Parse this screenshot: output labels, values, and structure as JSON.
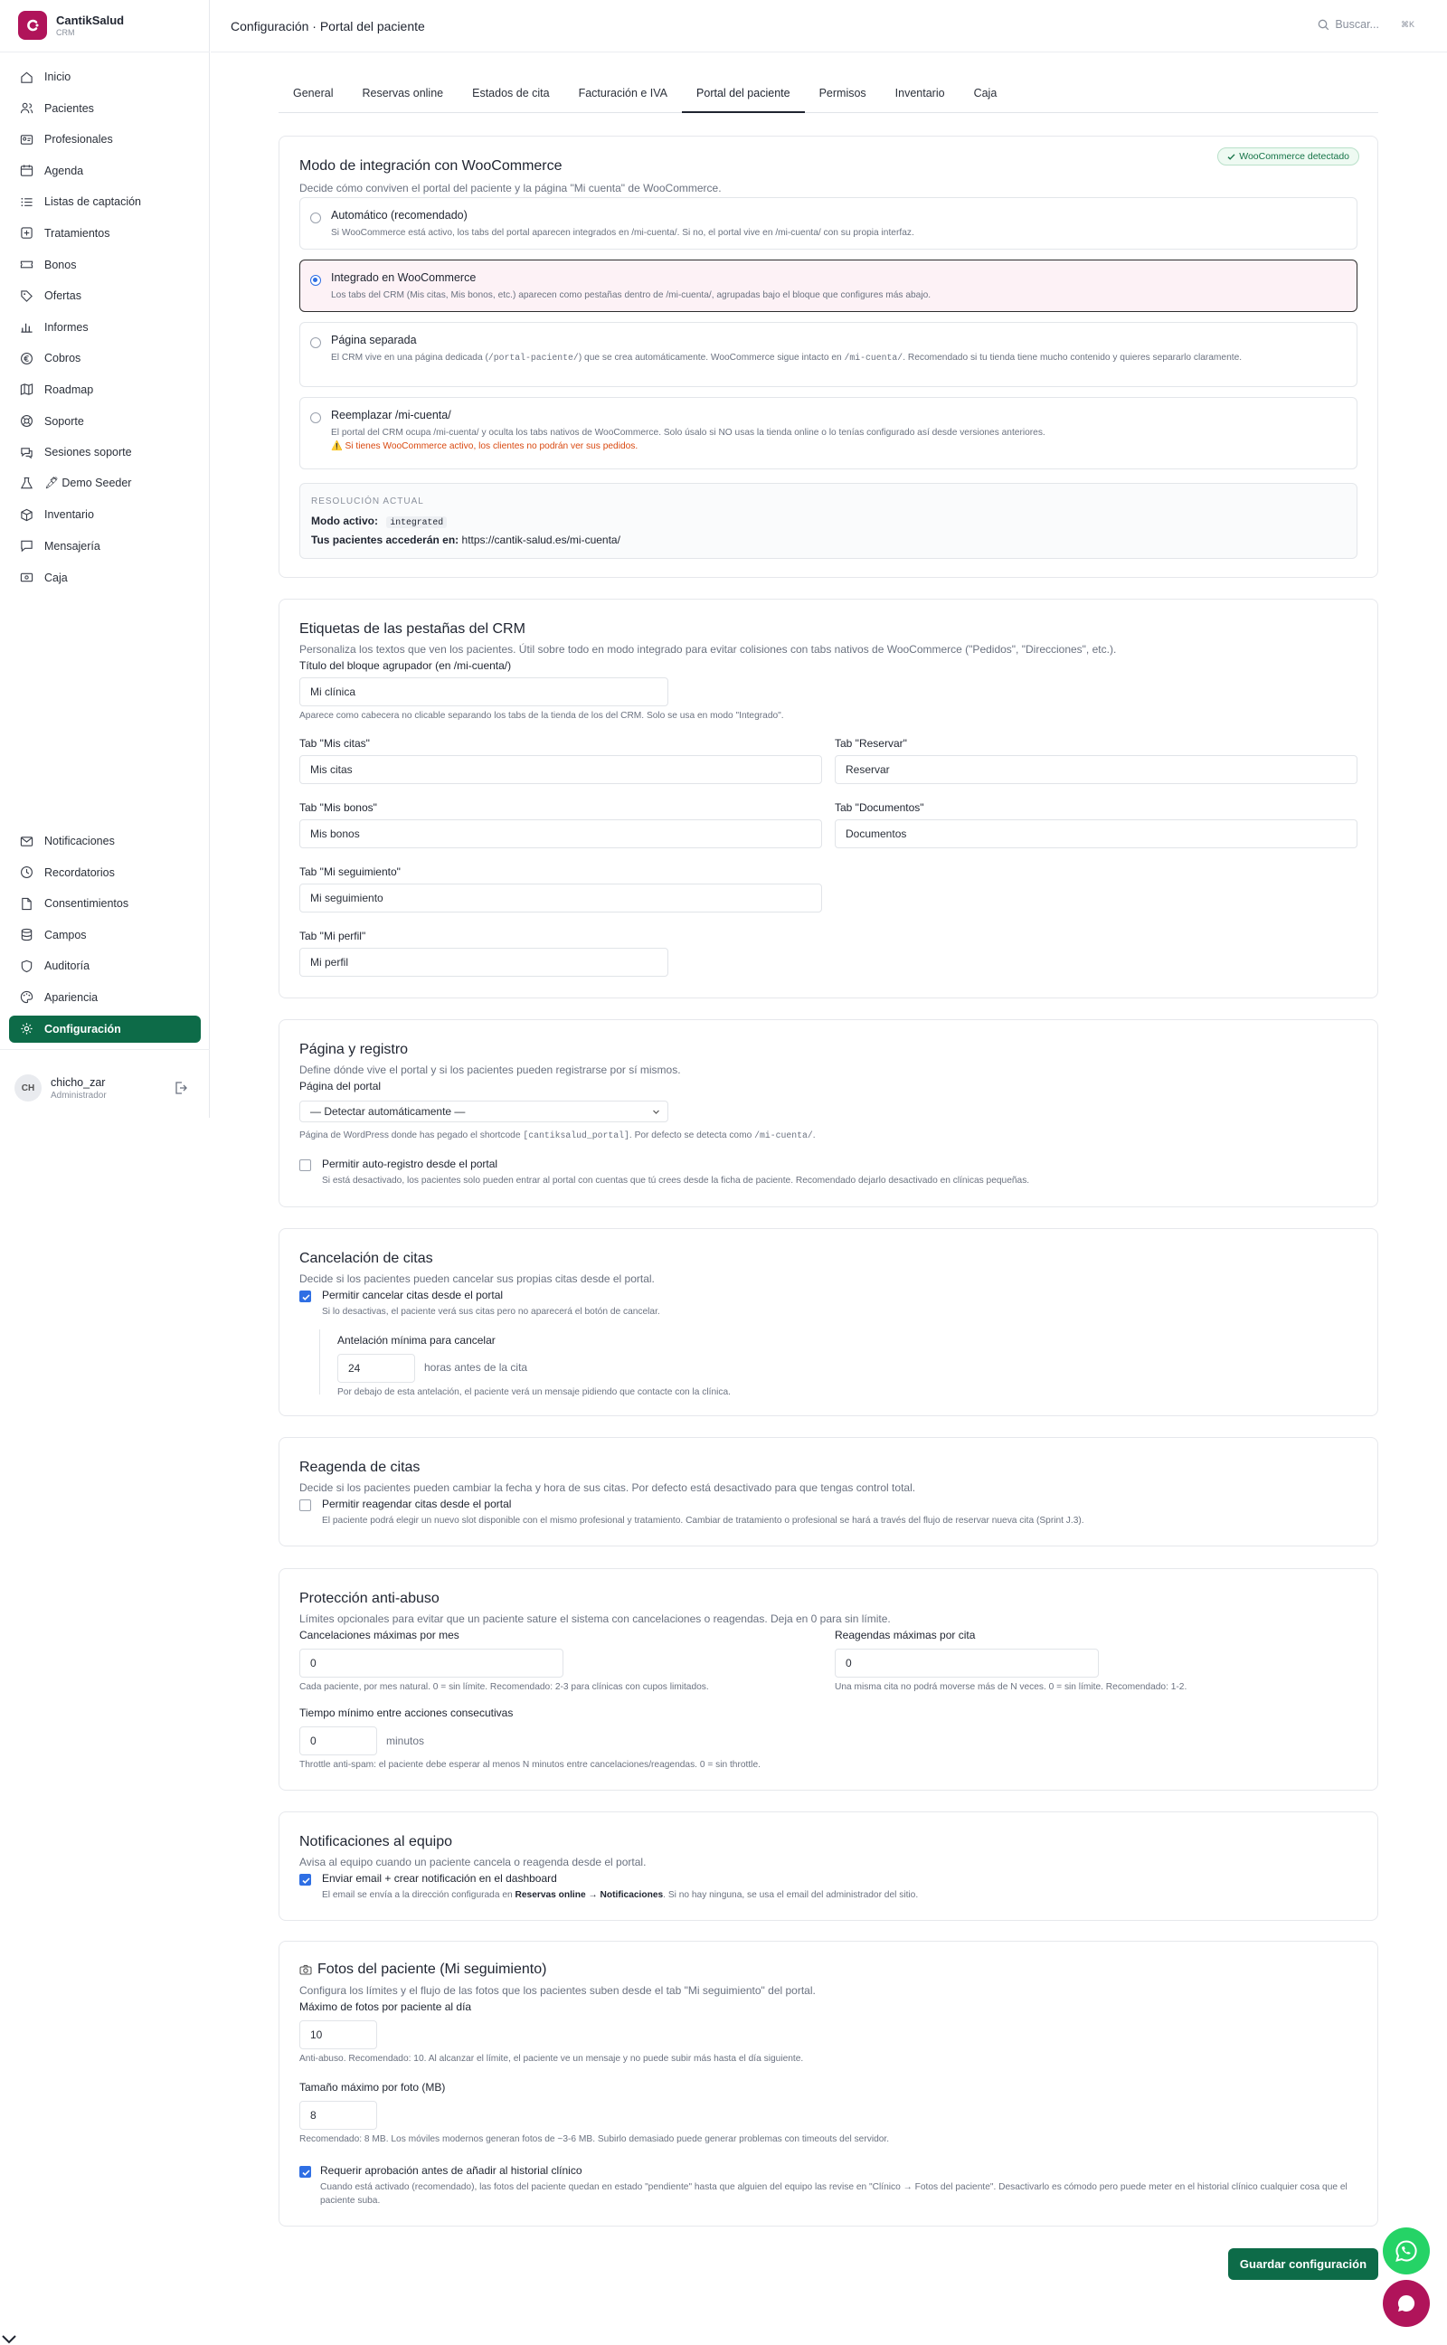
{
  "brand": {
    "name": "CantikSalud",
    "sub": "CRM",
    "color": "#b0145a"
  },
  "header": {
    "title": "Configuración · Portal del paciente",
    "search_placeholder": "Buscar...",
    "shortcut": "⌘K"
  },
  "sidebar": {
    "items": [
      {
        "label": "Inicio",
        "icon": "home-icon"
      },
      {
        "label": "Pacientes",
        "icon": "users-icon"
      },
      {
        "label": "Profesionales",
        "icon": "id-card-icon"
      },
      {
        "label": "Agenda",
        "icon": "calendar-icon"
      },
      {
        "label": "Listas de captación",
        "icon": "list-icon"
      },
      {
        "label": "Tratamientos",
        "icon": "treatment-icon"
      },
      {
        "label": "Bonos",
        "icon": "ticket-icon"
      },
      {
        "label": "Ofertas",
        "icon": "tag-icon"
      },
      {
        "label": "Informes",
        "icon": "bar-chart-icon"
      },
      {
        "label": "Cobros",
        "icon": "euro-icon"
      },
      {
        "label": "Roadmap",
        "icon": "map-icon"
      },
      {
        "label": "Soporte",
        "icon": "lifebuoy-icon"
      },
      {
        "label": "Sesiones soporte",
        "icon": "chat-icon"
      },
      {
        "label": "🖋 Demo Seeder",
        "icon": "flask-icon"
      },
      {
        "label": "Inventario",
        "icon": "box-icon"
      },
      {
        "label": "Mensajería",
        "icon": "message-icon"
      },
      {
        "label": "Caja",
        "icon": "cash-register-icon"
      }
    ],
    "bottom_items": [
      {
        "label": "Notificaciones",
        "icon": "mail-icon"
      },
      {
        "label": "Recordatorios",
        "icon": "clock-icon"
      },
      {
        "label": "Consentimientos",
        "icon": "file-icon"
      },
      {
        "label": "Campos",
        "icon": "database-icon"
      },
      {
        "label": "Auditoría",
        "icon": "shield-icon"
      },
      {
        "label": "Apariencia",
        "icon": "palette-icon"
      },
      {
        "label": "Configuración",
        "icon": "gear-icon"
      }
    ],
    "active": "Configuración",
    "user": {
      "initials": "CH",
      "name": "chicho_zar",
      "role": "Administrador"
    }
  },
  "tabs": [
    "General",
    "Reservas online",
    "Estados de cita",
    "Facturación e IVA",
    "Portal del paciente",
    "Permisos",
    "Inventario",
    "Caja"
  ],
  "active_tab": "Portal del paciente",
  "integration": {
    "title": "Modo de integración con WooCommerce",
    "desc": "Decide cómo conviven el portal del paciente y la página \"Mi cuenta\" de WooCommerce.",
    "badge": "WooCommerce detectado",
    "options": [
      {
        "title": "Automático (recomendado)",
        "desc": "Si WooCommerce está activo, los tabs del portal aparecen integrados en /mi-cuenta/. Si no, el portal vive en /mi-cuenta/ con su propia interfaz.",
        "selected": false
      },
      {
        "title": "Integrado en WooCommerce",
        "desc": "Los tabs del CRM (Mis citas, Mis bonos, etc.) aparecen como pestañas dentro de /mi-cuenta/, agrupadas bajo el bloque que configures más abajo.",
        "selected": true
      },
      {
        "title": "Página separada",
        "desc_a": "El CRM vive en una página dedicada (",
        "code_a": "/portal-paciente/",
        "desc_b": ") que se crea automáticamente. WooCommerce sigue intacto en ",
        "code_b": "/mi-cuenta/",
        "desc_c": ". Recomendado si tu tienda tiene mucho contenido y quieres separarlo claramente.",
        "selected": false
      },
      {
        "title": "Reemplazar /mi-cuenta/",
        "desc": "El portal del CRM ocupa /mi-cuenta/ y oculta los tabs nativos de WooCommerce. Solo úsalo si NO usas la tienda online o lo tenías configurado así desde versiones anteriores.",
        "warning": "⚠️ Si tienes WooCommerce activo, los clientes no podrán ver sus pedidos.",
        "selected": false
      }
    ],
    "resolution": {
      "label": "RESOLUCIÓN ACTUAL",
      "mode_label": "Modo activo:",
      "mode_value": "integrated",
      "access_label": "Tus pacientes accederán en:",
      "access_url": "https://cantik-salud.es/mi-cuenta/"
    }
  },
  "labels": {
    "title": "Etiquetas de las pestañas del CRM",
    "desc": "Personaliza los textos que ven los pacientes. Útil sobre todo en modo integrado para evitar colisiones con tabs nativos de WooCommerce (\"Pedidos\", \"Direcciones\", etc.).",
    "group_label": "Título del bloque agrupador (en /mi-cuenta/)",
    "group_value": "Mi clínica",
    "group_hint": "Aparece como cabecera no clicable separando los tabs de la tienda de los del CRM. Solo se usa en modo \"Integrado\".",
    "fields": {
      "citas_label": "Tab \"Mis citas\"",
      "citas_value": "Mis citas",
      "reservar_label": "Tab \"Reservar\"",
      "reservar_value": "Reservar",
      "bonos_label": "Tab \"Mis bonos\"",
      "bonos_value": "Mis bonos",
      "documentos_label": "Tab \"Documentos\"",
      "documentos_value": "Documentos",
      "seguimiento_label": "Tab \"Mi seguimiento\"",
      "seguimiento_value": "Mi seguimiento",
      "perfil_label": "Tab \"Mi perfil\"",
      "perfil_value": "Mi perfil"
    }
  },
  "page": {
    "title": "Página y registro",
    "desc": "Define dónde vive el portal y si los pacientes pueden registrarse por sí mismos.",
    "portal_label": "Página del portal",
    "portal_select": "— Detectar automáticamente —",
    "portal_hint_a": "Página de WordPress donde has pegado el shortcode ",
    "portal_hint_code": "[cantiksalud_portal]",
    "portal_hint_b": ". Por defecto se detecta como ",
    "portal_hint_code2": "/mi-cuenta/",
    "portal_hint_c": ".",
    "register_label": "Permitir auto-registro desde el portal",
    "register_hint": "Si está desactivado, los pacientes solo pueden entrar al portal con cuentas que tú crees desde la ficha de paciente. Recomendado dejarlo desactivado en clínicas pequeñas.",
    "register_checked": false
  },
  "cancel": {
    "title": "Cancelación de citas",
    "desc": "Decide si los pacientes pueden cancelar sus propias citas desde el portal.",
    "allow_label": "Permitir cancelar citas desde el portal",
    "allow_hint": "Si lo desactivas, el paciente verá sus citas pero no aparecerá el botón de cancelar.",
    "allow_checked": true,
    "min_label": "Antelación mínima para cancelar",
    "min_value": "24",
    "min_unit": "horas antes de la cita",
    "min_hint": "Por debajo de esta antelación, el paciente verá un mensaje pidiendo que contacte con la clínica."
  },
  "reschedule": {
    "title": "Reagenda de citas",
    "desc": "Decide si los pacientes pueden cambiar la fecha y hora de sus citas. Por defecto está desactivado para que tengas control total.",
    "allow_label": "Permitir reagendar citas desde el portal",
    "allow_hint": "El paciente podrá elegir un nuevo slot disponible con el mismo profesional y tratamiento. Cambiar de tratamiento o profesional se hará a través del flujo de reservar nueva cita (Sprint J.3).",
    "allow_checked": false
  },
  "abuse": {
    "title": "Protección anti-abuso",
    "desc": "Límites opcionales para evitar que un paciente sature el sistema con cancelaciones o reagendas. Deja en 0 para sin límite.",
    "cancel_label": "Cancelaciones máximas por mes",
    "cancel_value": "0",
    "cancel_hint": "Cada paciente, por mes natural. 0 = sin límite. Recomendado: 2-3 para clínicas con cupos limitados.",
    "resched_label": "Reagendas máximas por cita",
    "resched_value": "0",
    "resched_hint": "Una misma cita no podrá moverse más de N veces. 0 = sin límite. Recomendado: 1-2.",
    "gap_label": "Tiempo mínimo entre acciones consecutivas",
    "gap_value": "0",
    "gap_unit": "minutos",
    "gap_hint": "Throttle anti-spam: el paciente debe esperar al menos N minutos entre cancelaciones/reagendas. 0 = sin throttle."
  },
  "notify": {
    "title": "Notificaciones al equipo",
    "desc": "Avisa al equipo cuando un paciente cancela o reagenda desde el portal.",
    "label": "Enviar email + crear notificación en el dashboard",
    "hint_a": "El email se envía a la dirección configurada en ",
    "hint_bold1": "Reservas online",
    "hint_arrow": " → ",
    "hint_bold2": "Notificaciones",
    "hint_b": ". Si no hay ninguna, se usa el email del administrador del sitio.",
    "checked": true
  },
  "photos": {
    "title": "Fotos del paciente (Mi seguimiento)",
    "desc": "Configura los límites y el flujo de las fotos que los pacientes suben desde el tab \"Mi seguimiento\" del portal.",
    "daily_label": "Máximo de fotos por paciente al día",
    "daily_value": "10",
    "daily_hint": "Anti-abuso. Recomendado: 10. Al alcanzar el límite, el paciente ve un mensaje y no puede subir más hasta el día siguiente.",
    "size_label": "Tamaño máximo por foto (MB)",
    "size_value": "8",
    "size_hint": "Recomendado: 8 MB. Los móviles modernos generan fotos de ~3-6 MB. Subirlo demasiado puede generar problemas con timeouts del servidor.",
    "approve_label": "Requerir aprobación antes de añadir al historial clínico",
    "approve_hint": "Cuando está activado (recomendado), las fotos del paciente quedan en estado \"pendiente\" hasta que alguien del equipo las revise en \"Clínico → Fotos del paciente\". Desactivarlo es cómodo pero puede meter en el historial clínico cualquier cosa que el paciente suba.",
    "approve_checked": true
  },
  "save_label": "Guardar configuración",
  "colors": {
    "accent": "#0d6b48",
    "brand": "#b0145a",
    "check": "#2f6fe4",
    "whatsapp": "#25d366"
  }
}
